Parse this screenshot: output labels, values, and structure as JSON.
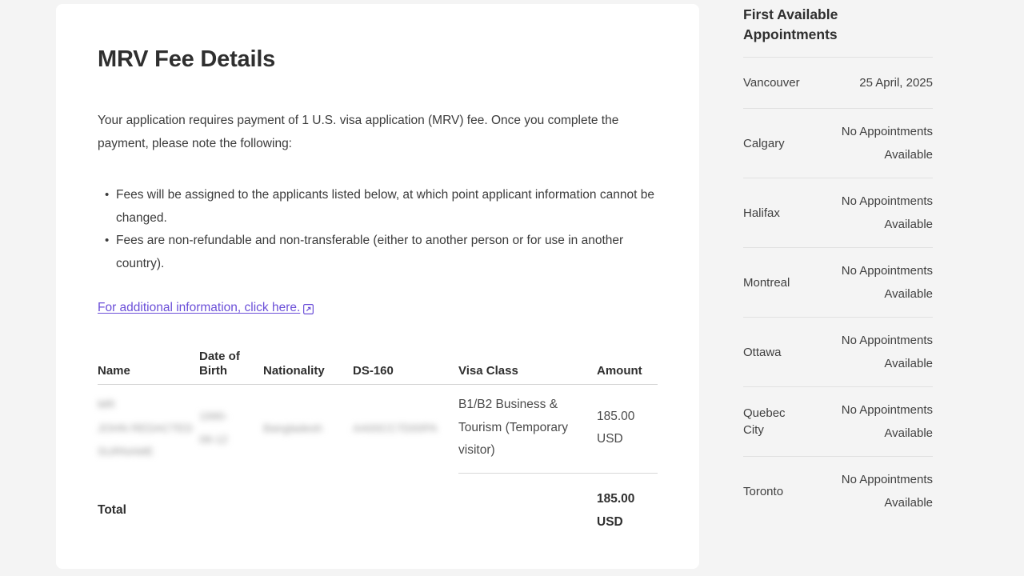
{
  "document": {
    "title": "MRV Fee Details",
    "intro": "Your application requires payment of 1 U.S. visa application (MRV) fee. Once you complete the payment, please note the following:",
    "notes": [
      "Fees will be assigned to the applicants listed below, at which point applicant information cannot be changed.",
      "Fees are non-refundable and non-transferable (either to another person or for use in another country)."
    ],
    "additional_info_link": "For additional information, click here.",
    "additional_info_icon": "external-link-icon",
    "link_color": "#6b4fd8"
  },
  "fee_table": {
    "headers": {
      "name": "Name",
      "date_of_birth": "Date of Birth",
      "nationality": "Nationality",
      "ds160": "DS-160",
      "visa_class": "Visa Class",
      "amount": "Amount"
    },
    "rows": [
      {
        "name": "MR\nJOHN REDACTED\nSURNAME",
        "date_of_birth": "1990-\n08-12",
        "nationality": "Bangladesh",
        "ds160": "AA00CC7D00PA",
        "visa_class": "B1/B2 Business & Tourism (Temporary visitor)",
        "amount": "185.00 USD",
        "redacted_fields": [
          "name",
          "date_of_birth",
          "nationality",
          "ds160"
        ]
      }
    ],
    "total_label": "Total",
    "total_amount": "185.00 USD"
  },
  "appointments": {
    "title": "First Available Appointments",
    "items": [
      {
        "city": "Vancouver",
        "status": "25 April, 2025"
      },
      {
        "city": "Calgary",
        "status": "No Appointments Available"
      },
      {
        "city": "Halifax",
        "status": "No Appointments Available"
      },
      {
        "city": "Montreal",
        "status": "No Appointments Available"
      },
      {
        "city": "Ottawa",
        "status": "No Appointments Available"
      },
      {
        "city": "Quebec City",
        "status": "No Appointments Available"
      },
      {
        "city": "Toronto",
        "status": "No Appointments Available"
      }
    ]
  }
}
